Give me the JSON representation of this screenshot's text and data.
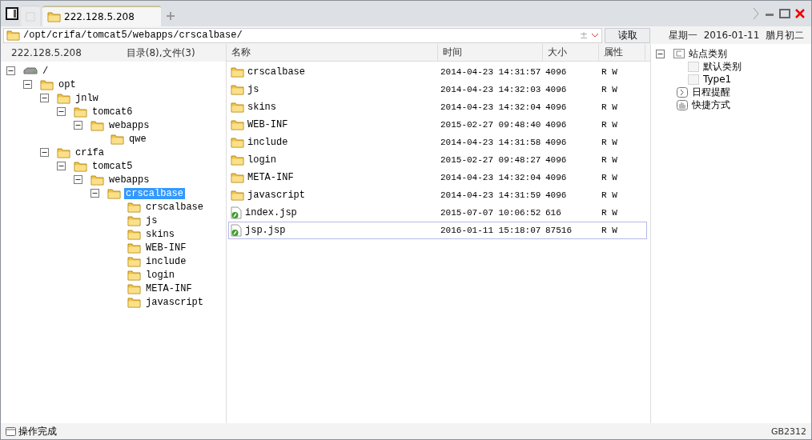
{
  "tabs": [
    {
      "kind": "blank",
      "selected": false
    },
    {
      "kind": "site",
      "label": "222.128.5.208",
      "selected": true
    }
  ],
  "address": {
    "value": "/opt/crifa/tomcat5/webapps/crscalbase/",
    "button": "读取",
    "dropdown_symbol": "±"
  },
  "date_line": "星期一  2016-01-11  腊月初二",
  "left_header": {
    "host": "222.128.5.208",
    "counts": "目录(8),文件(3)"
  },
  "tree": [
    {
      "label": "/",
      "kind": "drive",
      "expanded": true,
      "selected": false,
      "children": [
        {
          "label": "opt",
          "kind": "folder",
          "expanded": true,
          "selected": false,
          "children": [
            {
              "label": "jnlw",
              "kind": "folder",
              "expanded": true,
              "selected": false,
              "children": [
                {
                  "label": "tomcat6",
                  "kind": "folder",
                  "expanded": true,
                  "selected": false,
                  "children": [
                    {
                      "label": "webapps",
                      "kind": "folder",
                      "expanded": true,
                      "selected": false,
                      "children": [
                        {
                          "label": "qwe",
                          "kind": "folder",
                          "selected": false
                        }
                      ]
                    }
                  ]
                }
              ]
            },
            {
              "label": "crifa",
              "kind": "folder",
              "expanded": true,
              "selected": false,
              "children": [
                {
                  "label": "tomcat5",
                  "kind": "folder",
                  "expanded": true,
                  "selected": false,
                  "children": [
                    {
                      "label": "webapps",
                      "kind": "folder",
                      "expanded": true,
                      "selected": false,
                      "children": [
                        {
                          "label": "crscalbase",
                          "kind": "folder",
                          "expanded": true,
                          "selected": true,
                          "children": [
                            {
                              "label": "crscalbase",
                              "kind": "folder",
                              "selected": false
                            },
                            {
                              "label": "js",
                              "kind": "folder",
                              "selected": false
                            },
                            {
                              "label": "skins",
                              "kind": "folder",
                              "selected": false
                            },
                            {
                              "label": "WEB-INF",
                              "kind": "folder",
                              "selected": false
                            },
                            {
                              "label": "include",
                              "kind": "folder",
                              "selected": false
                            },
                            {
                              "label": "login",
                              "kind": "folder",
                              "selected": false
                            },
                            {
                              "label": "META-INF",
                              "kind": "folder",
                              "selected": false
                            },
                            {
                              "label": "javascript",
                              "kind": "folder",
                              "selected": false
                            }
                          ]
                        }
                      ]
                    }
                  ]
                }
              ]
            }
          ]
        }
      ]
    }
  ],
  "table": {
    "columns": [
      "名称",
      "时间",
      "大小",
      "属性"
    ],
    "rows": [
      {
        "kind": "folder",
        "name": "crscalbase",
        "time": "2014-04-23 14:31:57",
        "size": "4096",
        "attr": "R W",
        "selected": false
      },
      {
        "kind": "folder",
        "name": "js",
        "time": "2014-04-23 14:32:03",
        "size": "4096",
        "attr": "R W",
        "selected": false
      },
      {
        "kind": "folder",
        "name": "skins",
        "time": "2014-04-23 14:32:04",
        "size": "4096",
        "attr": "R W",
        "selected": false
      },
      {
        "kind": "folder",
        "name": "WEB-INF",
        "time": "2015-02-27 09:48:40",
        "size": "4096",
        "attr": "R W",
        "selected": false
      },
      {
        "kind": "folder",
        "name": "include",
        "time": "2014-04-23 14:31:58",
        "size": "4096",
        "attr": "R W",
        "selected": false
      },
      {
        "kind": "folder",
        "name": "login",
        "time": "2015-02-27 09:48:27",
        "size": "4096",
        "attr": "R W",
        "selected": false
      },
      {
        "kind": "folder",
        "name": "META-INF",
        "time": "2014-04-23 14:32:04",
        "size": "4096",
        "attr": "R W",
        "selected": false
      },
      {
        "kind": "folder",
        "name": "javascript",
        "time": "2014-04-23 14:31:59",
        "size": "4096",
        "attr": "R W",
        "selected": false
      },
      {
        "kind": "file",
        "name": "index.jsp",
        "time": "2015-07-07 10:06:52",
        "size": "616",
        "attr": "R W",
        "selected": false
      },
      {
        "kind": "file",
        "name": "jsp.jsp",
        "time": "2016-01-11 15:18:07",
        "size": "87516",
        "attr": "R W",
        "selected": true
      }
    ]
  },
  "side_tree": [
    {
      "label": "站点类别",
      "kind": "category",
      "expanded": true,
      "children": [
        {
          "label": "默认类别",
          "kind": "item"
        },
        {
          "label": "Type1",
          "kind": "item"
        }
      ]
    },
    {
      "label": "日程提醒",
      "kind": "schedule"
    },
    {
      "label": "快捷方式",
      "kind": "shortcut"
    }
  ],
  "status": {
    "message": "操作完成",
    "encoding": "GB2312"
  }
}
